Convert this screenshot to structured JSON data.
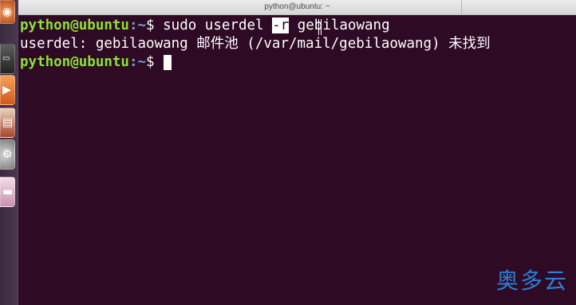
{
  "window": {
    "title": "python@ubuntu: ~"
  },
  "launcher": {
    "items": [
      {
        "name": "dash-home",
        "icon": "ubuntu-logo-icon"
      },
      {
        "name": "terminal",
        "icon": "terminal-icon"
      },
      {
        "name": "files",
        "icon": "files-icon"
      },
      {
        "name": "office",
        "icon": "office-icon"
      },
      {
        "name": "settings",
        "icon": "gear-icon"
      },
      {
        "name": "document",
        "icon": "document-icon"
      }
    ]
  },
  "terminal": {
    "line1": {
      "user": "python@ubuntu",
      "path": ":~",
      "symbol": "$ ",
      "cmd_before": "sudo userdel ",
      "cmd_selected": "-r",
      "cmd_after": " gebilaowang"
    },
    "line2": {
      "output": "userdel: gebilaowang 邮件池 (/var/mail/gebilaowang) 未找到"
    },
    "line3": {
      "user": "python@ubuntu",
      "path": ":~",
      "symbol": "$ "
    }
  },
  "colors": {
    "terminal_bg": "#2f0a24",
    "prompt_user": "#8ae234",
    "prompt_path": "#729fcf",
    "watermark": "#2b7fd6"
  },
  "watermark": {
    "text": "奥多云"
  }
}
